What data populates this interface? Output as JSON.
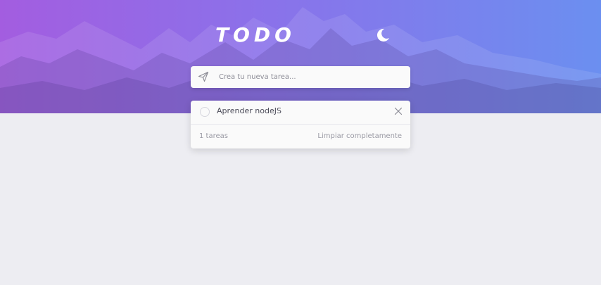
{
  "header": {
    "title": "TODO",
    "theme_toggle_icon": "moon-icon"
  },
  "new_task": {
    "placeholder": "Crea tu nueva tarea...",
    "value": "",
    "icon": "send-icon"
  },
  "todos": [
    {
      "text": "Aprender nodeJS",
      "completed": false
    }
  ],
  "footer": {
    "count_text": "1 tareas",
    "clear_label": "Limpiar completamente"
  },
  "colors": {
    "gradient_start": "#a35de0",
    "gradient_end": "#6b8ff0",
    "page_background": "#ededf2",
    "card_background": "#fafafa"
  }
}
